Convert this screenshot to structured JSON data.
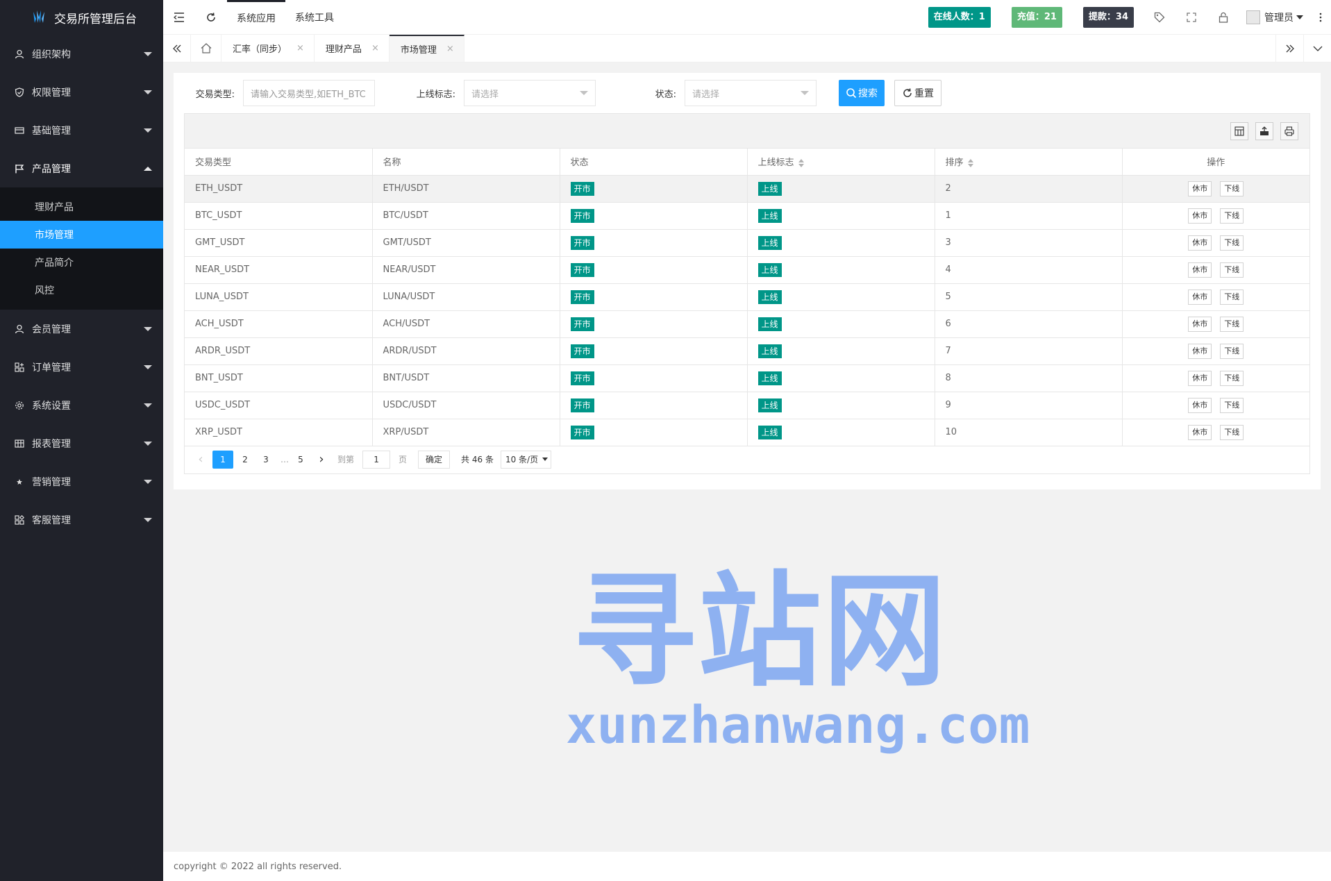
{
  "app": {
    "title": "交易所管理后台"
  },
  "sidebar": {
    "items": [
      {
        "label": "组织架构",
        "icon": "user-outline-icon"
      },
      {
        "label": "权限管理",
        "icon": "shield-icon"
      },
      {
        "label": "基础管理",
        "icon": "card-icon"
      },
      {
        "label": "产品管理",
        "icon": "flag-icon",
        "open": true
      },
      {
        "label": "会员管理",
        "icon": "user-icon"
      },
      {
        "label": "订单管理",
        "icon": "grid-plus-icon"
      },
      {
        "label": "系统设置",
        "icon": "gear-icon"
      },
      {
        "label": "报表管理",
        "icon": "table-icon"
      },
      {
        "label": "营销管理",
        "icon": "star-icon"
      },
      {
        "label": "客服管理",
        "icon": "apps-icon"
      }
    ],
    "submenu": [
      "理财产品",
      "市场管理",
      "产品简介",
      "风控"
    ],
    "active_sub": "市场管理"
  },
  "header": {
    "nav": [
      "系统应用",
      "系统工具"
    ],
    "stats": {
      "online": "在线人数：1",
      "recharge": "充值：21",
      "withdraw": "提款：34"
    },
    "user": "管理员"
  },
  "tabs": [
    {
      "label": "汇率（同步）",
      "close": "×"
    },
    {
      "label": "理财产品",
      "close": "×"
    },
    {
      "label": "市场管理",
      "close": "×",
      "active": true
    }
  ],
  "filter": {
    "type_label": "交易类型:",
    "type_placeholder": "请输入交易类型,如ETH_BTC",
    "online_label": "上线标志:",
    "online_placeholder": "请选择",
    "status_label": "状态:",
    "status_placeholder": "请选择",
    "search_btn": "搜索",
    "reset_btn": "重置"
  },
  "table": {
    "columns": [
      "交易类型",
      "名称",
      "状态",
      "上线标志",
      "排序",
      "操作"
    ],
    "rows": [
      {
        "type": "ETH_USDT",
        "name": "ETH/USDT",
        "status": "开市",
        "online": "上线",
        "sort": "2",
        "op1": "休市",
        "op2": "下线"
      },
      {
        "type": "BTC_USDT",
        "name": "BTC/USDT",
        "status": "开市",
        "online": "上线",
        "sort": "1",
        "op1": "休市",
        "op2": "下线"
      },
      {
        "type": "GMT_USDT",
        "name": "GMT/USDT",
        "status": "开市",
        "online": "上线",
        "sort": "3",
        "op1": "休市",
        "op2": "下线"
      },
      {
        "type": "NEAR_USDT",
        "name": "NEAR/USDT",
        "status": "开市",
        "online": "上线",
        "sort": "4",
        "op1": "休市",
        "op2": "下线"
      },
      {
        "type": "LUNA_USDT",
        "name": "LUNA/USDT",
        "status": "开市",
        "online": "上线",
        "sort": "5",
        "op1": "休市",
        "op2": "下线"
      },
      {
        "type": "ACH_USDT",
        "name": "ACH/USDT",
        "status": "开市",
        "online": "上线",
        "sort": "6",
        "op1": "休市",
        "op2": "下线"
      },
      {
        "type": "ARDR_USDT",
        "name": "ARDR/USDT",
        "status": "开市",
        "online": "上线",
        "sort": "7",
        "op1": "休市",
        "op2": "下线"
      },
      {
        "type": "BNT_USDT",
        "name": "BNT/USDT",
        "status": "开市",
        "online": "上线",
        "sort": "8",
        "op1": "休市",
        "op2": "下线"
      },
      {
        "type": "USDC_USDT",
        "name": "USDC/USDT",
        "status": "开市",
        "online": "上线",
        "sort": "9",
        "op1": "休市",
        "op2": "下线"
      },
      {
        "type": "XRP_USDT",
        "name": "XRP/USDT",
        "status": "开市",
        "online": "上线",
        "sort": "10",
        "op1": "休市",
        "op2": "下线"
      }
    ]
  },
  "pager": {
    "prev": "‹",
    "pages": [
      "1",
      "2",
      "3"
    ],
    "ellipsis": "…",
    "last": "5",
    "next": "›",
    "goto_label": "到第",
    "goto_value": "1",
    "page_unit": "页",
    "confirm": "确定",
    "total": "共 46 条",
    "limit": "10 条/页"
  },
  "watermark": {
    "cn": "寻站网",
    "en": "xunzhanwang.com"
  },
  "footer": {
    "text": "copyright © 2022 all rights reserved."
  },
  "colors": {
    "sidebar_bg": "#20222a",
    "accent": "#1e9fff",
    "tag_green": "#009688",
    "stat_light_green": "#5fb878",
    "stat_dark": "#393d49"
  }
}
